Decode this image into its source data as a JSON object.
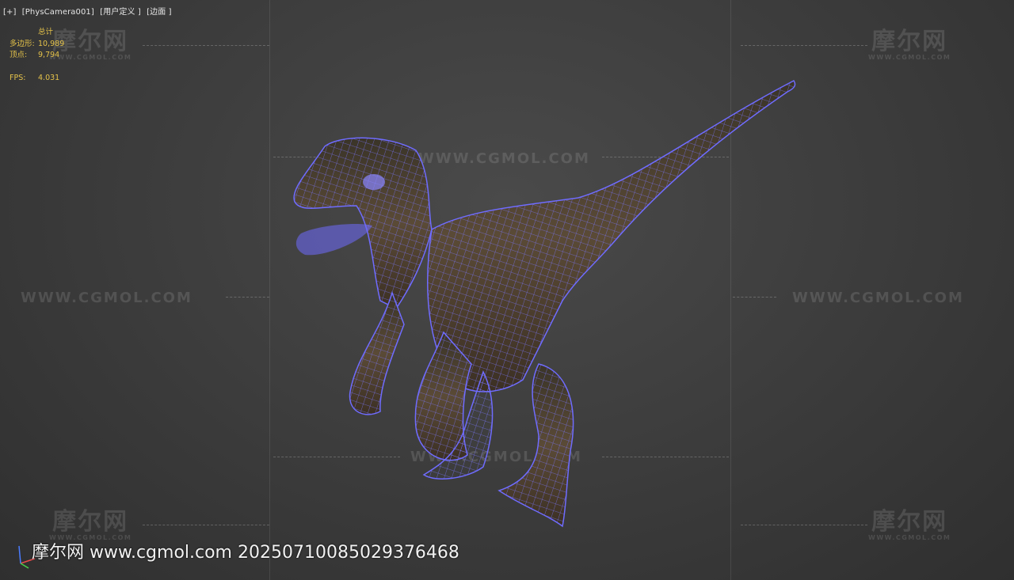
{
  "viewport": {
    "labels": [
      "[+]",
      "[PhysCamera001]",
      "[用户定义 ]",
      "[边面 ]"
    ]
  },
  "stats": {
    "header": "总计",
    "polygons_label": "多边形:",
    "polygons_value": "10,989",
    "vertices_label": "顶点:",
    "vertices_value": "9,794",
    "fps_label": "FPS:",
    "fps_value": "4.031"
  },
  "watermarks": {
    "url": "WWW.CGMOL.COM",
    "brand_cn": "摩尔网",
    "brand_sub": "WWW.CGMOL.COM"
  },
  "footer": {
    "text": "摩尔网 www.cgmol.com 2025071008502937646​8"
  },
  "colors": {
    "wireframe": "#6f6cff",
    "stats": "#e4c24a",
    "axis_x": "#e84a4a",
    "axis_y": "#4ad04a",
    "axis_z": "#4a7cff"
  },
  "icons": {
    "axis": "axis-gizmo-icon",
    "model": "velociraptor-wireframe"
  }
}
